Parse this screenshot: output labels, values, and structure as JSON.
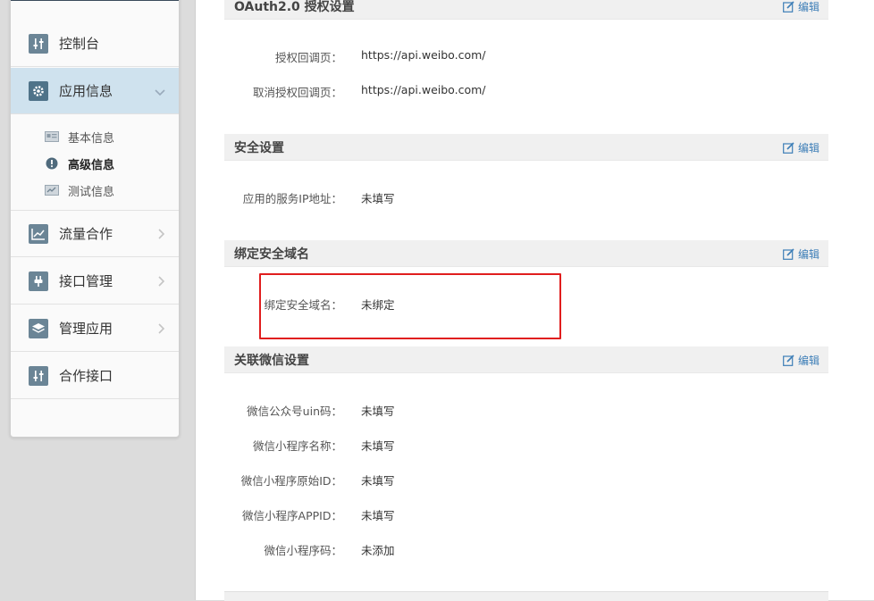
{
  "sidebar": {
    "items": [
      {
        "label": "控制台"
      },
      {
        "label": "应用信息"
      },
      {
        "label": "流量合作"
      },
      {
        "label": "接口管理"
      },
      {
        "label": "管理应用"
      },
      {
        "label": "合作接口"
      }
    ],
    "subitems": [
      {
        "label": "基本信息"
      },
      {
        "label": "高级信息"
      },
      {
        "label": "测试信息"
      }
    ]
  },
  "sections": {
    "oauth": {
      "title": "OAuth2.0 授权设置",
      "edit": "编辑",
      "rows": [
        {
          "label": "授权回调页：",
          "value": "https://api.weibo.com/"
        },
        {
          "label": "取消授权回调页：",
          "value": "https://api.weibo.com/"
        }
      ]
    },
    "security": {
      "title": "安全设置",
      "edit": "编辑",
      "rows": [
        {
          "label": "应用的服务IP地址：",
          "value": "未填写"
        }
      ]
    },
    "domain": {
      "title": "绑定安全域名",
      "edit": "编辑",
      "rows": [
        {
          "label": "绑定安全域名：",
          "value": "未绑定"
        }
      ]
    },
    "wechat": {
      "title": "关联微信设置",
      "edit": "编辑",
      "rows": [
        {
          "label": "微信公众号uin码：",
          "value": "未填写"
        },
        {
          "label": "微信小程序名称：",
          "value": "未填写"
        },
        {
          "label": "微信小程序原始ID：",
          "value": "未填写"
        },
        {
          "label": "微信小程序APPID：",
          "value": "未填写"
        },
        {
          "label": "微信小程序码：",
          "value": "未添加"
        }
      ]
    }
  },
  "colors": {
    "active_bg": "#cfe2ee",
    "link": "#3d7eb7",
    "highlight": "#e01e1e"
  }
}
